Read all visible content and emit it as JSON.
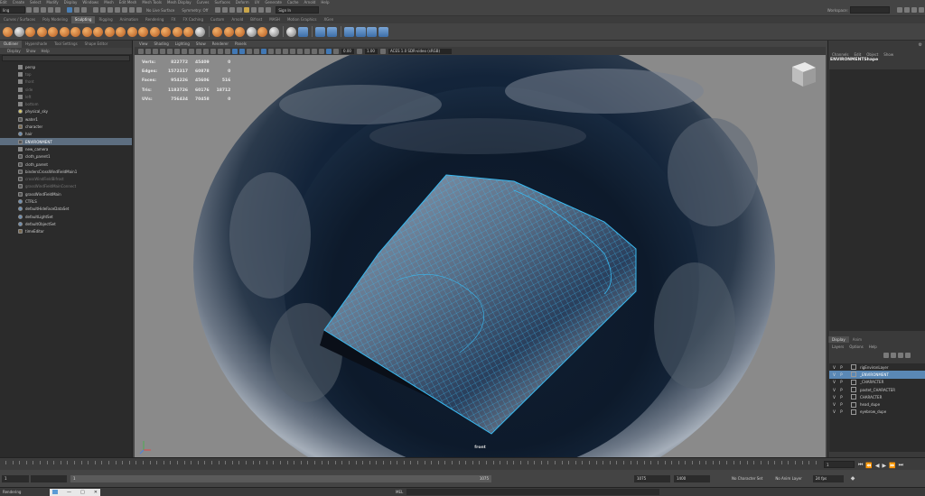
{
  "menubar": {
    "items": [
      "Edit",
      "Create",
      "Select",
      "Modify",
      "Display",
      "Windows",
      "Mesh",
      "Edit Mesh",
      "Mesh Tools",
      "Mesh Display",
      "Curves",
      "Surfaces",
      "Deform",
      "UV",
      "Generate",
      "Cache",
      "Arnold",
      "Help"
    ],
    "workspace_label": "Workspace:"
  },
  "status": {
    "mode": "ling",
    "no_live_surface": "No Live Surface",
    "symmetry": "Symmetry: Off",
    "sign_in": "Sign In"
  },
  "shelf": {
    "tabs": [
      "Curves / Surfaces",
      "Poly Modeling",
      "Sculpting",
      "Rigging",
      "Animation",
      "Rendering",
      "FX",
      "FX Caching",
      "Custom",
      "Arnold",
      "Bifrost",
      "MASH",
      "Motion Graphics",
      "XGen"
    ],
    "active_tab": 2
  },
  "outliner": {
    "tabs": [
      "Outliner",
      "Hypershade",
      "Tool Settings",
      "Shape Editor"
    ],
    "menu": [
      "Display",
      "Show",
      "Help"
    ],
    "items": [
      {
        "label": "persp",
        "icon": "camera-icon",
        "state": "normal"
      },
      {
        "label": "top",
        "icon": "camera-icon",
        "state": "dim"
      },
      {
        "label": "front",
        "icon": "camera-icon",
        "state": "dim"
      },
      {
        "label": "side",
        "icon": "camera-icon",
        "state": "dim"
      },
      {
        "label": "left",
        "icon": "camera-icon",
        "state": "dim"
      },
      {
        "label": "bottom",
        "icon": "camera-icon",
        "state": "dim"
      },
      {
        "label": "physical_sky",
        "icon": "light-icon",
        "state": "normal"
      },
      {
        "label": "water1",
        "icon": "mesh-icon",
        "state": "normal"
      },
      {
        "label": "character",
        "icon": "group-icon",
        "state": "normal"
      },
      {
        "label": "hair",
        "icon": "set-icon",
        "state": "normal"
      },
      {
        "label": "ENVIRONMENT",
        "icon": "mesh-icon",
        "state": "selected"
      },
      {
        "label": "new_camera",
        "icon": "camera-icon",
        "state": "normal"
      },
      {
        "label": "cloth_parent1",
        "icon": "mesh-icon",
        "state": "normal"
      },
      {
        "label": "cloth_parent",
        "icon": "mesh-icon",
        "state": "normal"
      },
      {
        "label": "bindersCrossWindFieldMain1",
        "icon": "mesh-icon",
        "state": "normal"
      },
      {
        "label": "crossWindFieldBifrost",
        "icon": "mesh-icon",
        "state": "dim"
      },
      {
        "label": "grassWindFieldMainConnect",
        "icon": "mesh-icon",
        "state": "dim"
      },
      {
        "label": "grassWindFieldMain",
        "icon": "mesh-icon",
        "state": "normal"
      },
      {
        "label": "CTRLS",
        "icon": "set-icon",
        "state": "normal"
      },
      {
        "label": "defaultHideFaceDataSet",
        "icon": "set-icon",
        "state": "normal"
      },
      {
        "label": "defaultLightSet",
        "icon": "set-icon",
        "state": "normal"
      },
      {
        "label": "defaultObjectSet",
        "icon": "set-icon",
        "state": "normal"
      },
      {
        "label": "timeEditor",
        "icon": "group-icon",
        "state": "normal"
      }
    ]
  },
  "viewport": {
    "menu": [
      "View",
      "Shading",
      "Lighting",
      "Show",
      "Renderer",
      "Panels"
    ],
    "exposure": "0.00",
    "gamma": "1.00",
    "colorspace": "ACES 1.0 SDR-video (sRGB)",
    "camera_label": "front",
    "hud": [
      {
        "label": "Verts:",
        "a": "822772",
        "b": "45409",
        "c": "0"
      },
      {
        "label": "Edges:",
        "a": "1572317",
        "b": "60878",
        "c": "0"
      },
      {
        "label": "Faces:",
        "a": "954226",
        "b": "45606",
        "c": "516"
      },
      {
        "label": "Tris:",
        "a": "1183726",
        "b": "60176",
        "c": "18712"
      },
      {
        "label": "UVs:",
        "a": "756434",
        "b": "70458",
        "c": "0"
      }
    ]
  },
  "channelbox": {
    "menu": [
      "Channels",
      "Edit",
      "Object",
      "Show"
    ],
    "node_name": "ENVIRONMENTShape"
  },
  "layers": {
    "tabs": [
      "Display",
      "Anim"
    ],
    "menu": [
      "Layers",
      "Options",
      "Help"
    ],
    "items": [
      {
        "v": "V",
        "p": "P",
        "label": "rigEnvironLayer",
        "selected": false
      },
      {
        "v": "V",
        "p": "P",
        "label": "_ENVIRONMENT",
        "selected": true
      },
      {
        "v": "V",
        "p": "P",
        "label": "_CHARACTER",
        "selected": false
      },
      {
        "v": "V",
        "p": "P",
        "label": "pastet_CHARACTER",
        "selected": false
      },
      {
        "v": "V",
        "p": "P",
        "label": "CHARACTER",
        "selected": false
      },
      {
        "v": "V",
        "p": "P",
        "label": "head_dupe",
        "selected": false
      },
      {
        "v": "V",
        "p": "P",
        "label": "eyebrow_dupe",
        "selected": false
      }
    ]
  },
  "timeline": {
    "current_frame": "1",
    "range_start": "1",
    "range_start_inner": "1",
    "range_end_inner": "1075",
    "range_end": "1075",
    "range_end_outer": "1400",
    "character_set": "No Character Set",
    "anim_layer": "No Anim Layer",
    "fps": "24 fps",
    "status_text": "Rendering",
    "mel_label": "MEL"
  },
  "colors": {
    "wire": "#39b9f0",
    "selected_row": "#5d6e80",
    "selected_layer": "#5a88b5"
  }
}
